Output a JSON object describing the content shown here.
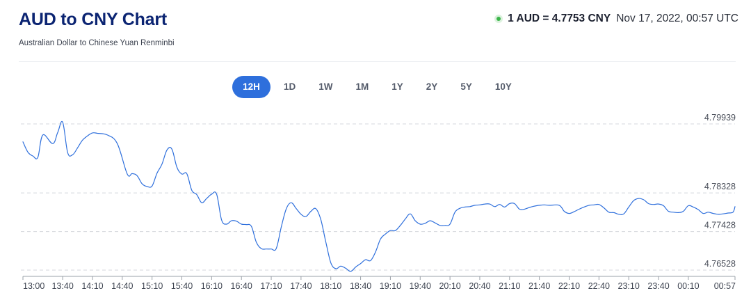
{
  "header": {
    "title": "AUD to CNY Chart",
    "subtitle": "Australian Dollar to Chinese Yuan Renminbi"
  },
  "rate": {
    "value": "1 AUD = 4.7753 CNY",
    "timestamp": "Nov 17, 2022, 00:57 UTC",
    "status_color": "#3bb54a"
  },
  "range_tabs": {
    "items": [
      "12H",
      "1D",
      "1W",
      "1M",
      "1Y",
      "2Y",
      "5Y",
      "10Y"
    ],
    "selected": "12H"
  },
  "colors": {
    "line": "#2e6fdc",
    "accent": "#2e6fdc",
    "title": "#0b2472"
  },
  "chart_data": {
    "type": "line",
    "title": "",
    "xlabel": "",
    "ylabel": "",
    "x_ticks": [
      "13:00",
      "13:40",
      "14:10",
      "14:40",
      "15:10",
      "15:40",
      "16:10",
      "16:40",
      "17:10",
      "17:40",
      "18:10",
      "18:40",
      "19:10",
      "19:40",
      "20:10",
      "20:40",
      "21:10",
      "21:40",
      "22:10",
      "22:40",
      "23:10",
      "23:40",
      "00:10",
      "00:57"
    ],
    "y_ticks": [
      4.79939,
      4.78328,
      4.77428,
      4.76528
    ],
    "ylim": [
      4.76528,
      4.79939
    ],
    "grid": "horizontal-dashed",
    "series": [
      {
        "x": [
          "13:00",
          "13:05",
          "13:10",
          "13:15",
          "13:20",
          "13:30",
          "13:35",
          "13:40",
          "13:45",
          "13:50",
          "13:55",
          "14:00",
          "14:05",
          "14:10",
          "14:15",
          "14:25",
          "14:35",
          "14:45",
          "14:50",
          "14:55",
          "15:00",
          "15:05",
          "15:10",
          "15:15",
          "15:20",
          "15:25",
          "15:30",
          "15:35",
          "15:40",
          "15:45",
          "15:50",
          "15:55",
          "16:00",
          "16:05",
          "16:10",
          "16:15",
          "16:20",
          "16:25",
          "16:30",
          "16:35",
          "16:40",
          "16:45",
          "16:50",
          "16:55",
          "17:00",
          "17:05",
          "17:10",
          "17:15",
          "17:20",
          "17:25",
          "17:30",
          "17:35",
          "17:40",
          "17:45",
          "17:50",
          "17:55",
          "18:00",
          "18:05",
          "18:10",
          "18:15",
          "18:20",
          "18:25",
          "18:30",
          "18:35",
          "18:40",
          "18:45",
          "18:50",
          "18:55",
          "19:00",
          "19:05",
          "19:10",
          "19:15",
          "19:20",
          "19:25",
          "19:30",
          "19:35",
          "19:40",
          "19:45",
          "19:50",
          "19:55",
          "20:00",
          "20:05",
          "20:10",
          "20:15",
          "20:20",
          "20:25",
          "20:30",
          "20:35",
          "20:40",
          "20:45",
          "20:50",
          "20:55",
          "21:00",
          "21:05",
          "21:10",
          "21:15",
          "21:20",
          "21:25",
          "21:30",
          "21:35",
          "21:40",
          "21:45",
          "21:50",
          "22:00",
          "22:05",
          "22:10",
          "22:15",
          "22:20",
          "22:25",
          "22:30",
          "22:35",
          "22:40",
          "22:45",
          "22:50",
          "22:55",
          "23:00",
          "23:05",
          "23:10",
          "23:15",
          "23:20",
          "23:25",
          "23:30",
          "23:35",
          "23:40",
          "23:45",
          "23:50",
          "23:55",
          "00:00",
          "00:05",
          "00:10",
          "00:15",
          "00:20",
          "00:25",
          "00:30",
          "00:35",
          "00:40",
          "00:45",
          "00:50",
          "00:55",
          "00:57"
        ],
        "y": [
          4.7952,
          4.7928,
          4.7919,
          4.7916,
          4.7968,
          4.7948,
          4.7974,
          4.7998,
          4.7927,
          4.7922,
          4.7938,
          4.7956,
          4.7966,
          4.7973,
          4.7972,
          4.7968,
          4.7948,
          4.7877,
          4.7878,
          4.7873,
          4.7854,
          4.7848,
          4.7849,
          4.7879,
          4.79,
          4.7933,
          4.7935,
          4.7893,
          4.7877,
          4.7878,
          4.7839,
          4.7829,
          4.781,
          4.782,
          4.783,
          4.783,
          4.777,
          4.776,
          4.7768,
          4.7767,
          4.776,
          4.7759,
          4.7755,
          4.7718,
          4.7703,
          4.7702,
          4.7702,
          4.7703,
          4.7752,
          4.7795,
          4.781,
          4.7797,
          4.7783,
          4.7778,
          4.779,
          4.7796,
          4.777,
          4.7718,
          4.767,
          4.7656,
          4.7662,
          4.7657,
          4.765,
          4.766,
          4.7668,
          4.7677,
          4.7675,
          4.7695,
          4.7725,
          4.7737,
          4.7745,
          4.7745,
          4.7757,
          4.7772,
          4.7784,
          4.7768,
          4.776,
          4.7762,
          4.7768,
          4.7763,
          4.7757,
          4.7757,
          4.776,
          4.7788,
          4.7797,
          4.78,
          4.7801,
          4.7804,
          4.7805,
          4.7807,
          4.7807,
          4.7801,
          4.7806,
          4.78,
          4.7808,
          4.7808,
          4.7795,
          4.7795,
          4.7799,
          4.7802,
          4.7804,
          4.7805,
          4.7804,
          4.7804,
          4.779,
          4.7785,
          4.7789,
          4.7795,
          4.78,
          4.7804,
          4.7805,
          4.7806,
          4.7798,
          4.7788,
          4.7787,
          4.7783,
          4.7784,
          4.78,
          4.7815,
          4.782,
          4.7817,
          4.7808,
          4.7806,
          4.7807,
          4.7803,
          4.779,
          4.7788,
          4.7787,
          4.779,
          4.7803,
          4.78,
          4.7794,
          4.7785,
          4.7788,
          4.7785,
          4.7783,
          4.7784,
          4.7786,
          4.7788,
          4.7801
        ]
      }
    ]
  }
}
